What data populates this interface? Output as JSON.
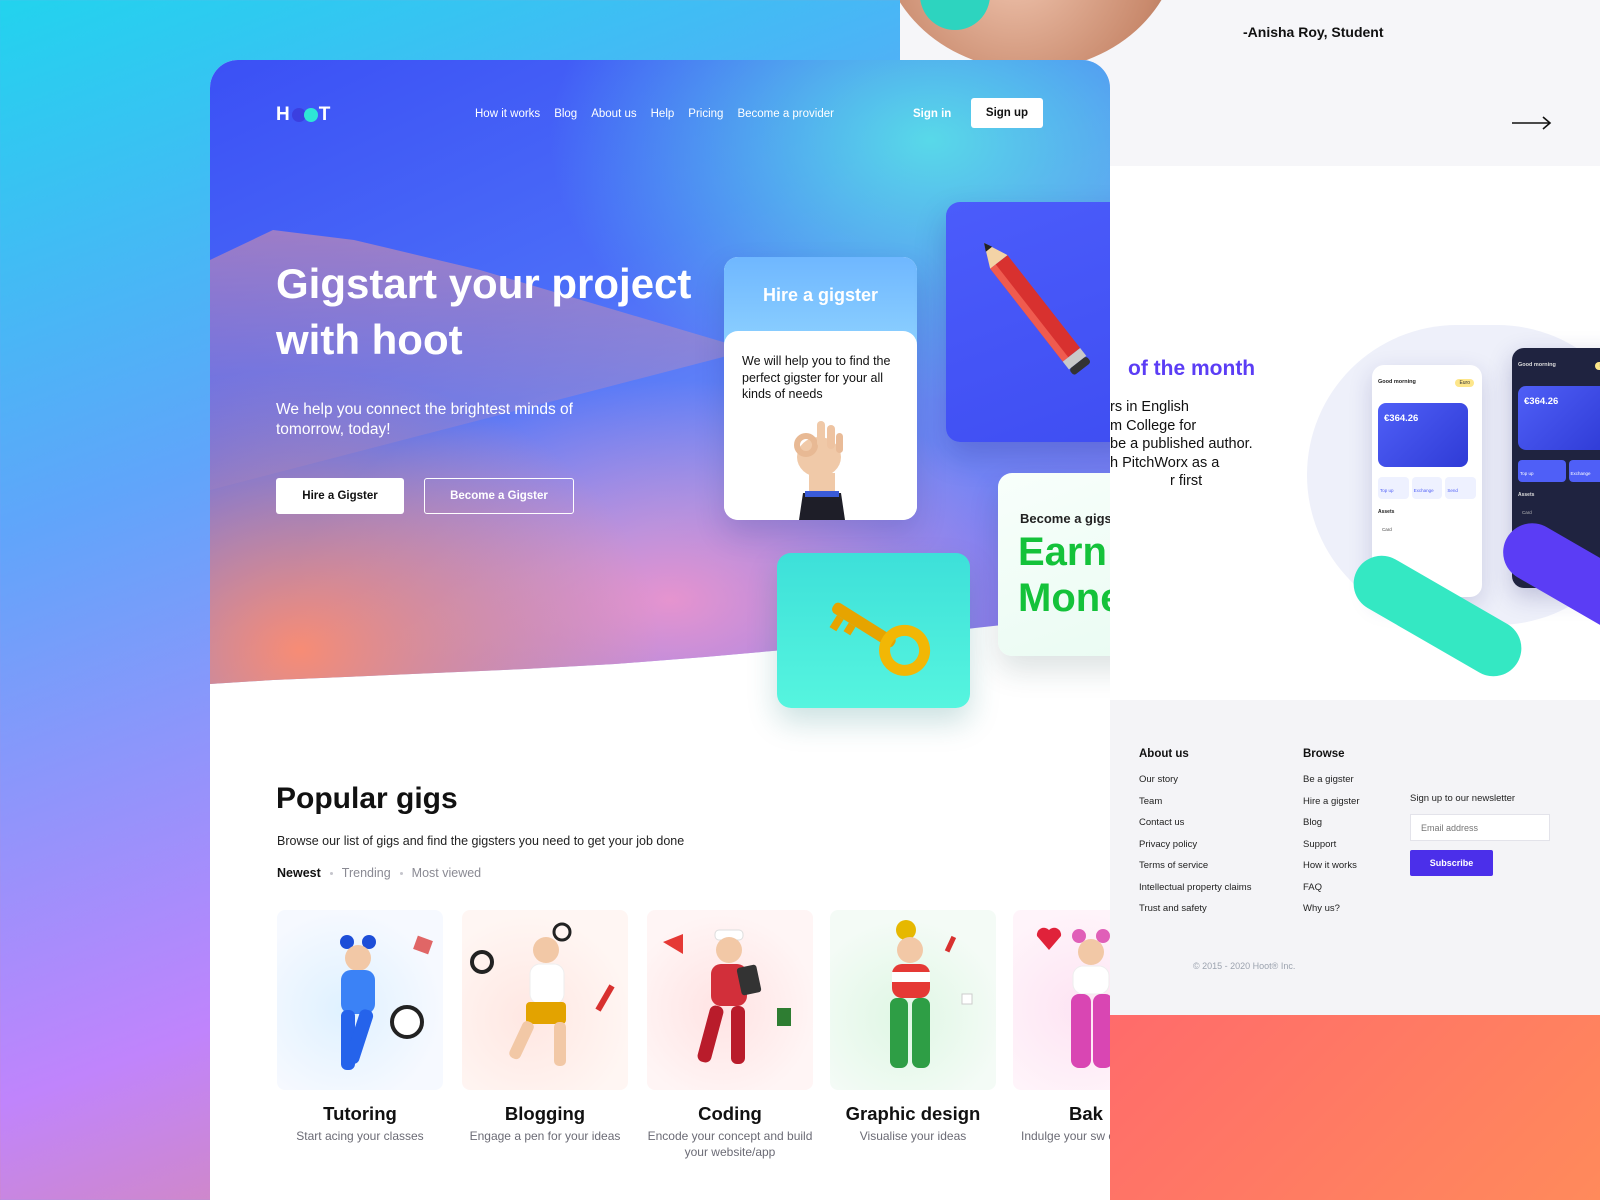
{
  "testimonial": {
    "author": "-Anisha Roy, Student"
  },
  "feature": {
    "title_fragment": "of the month",
    "text_lines": [
      "rs in English",
      "m College for",
      "be a published author.",
      "h PitchWorx as a",
      "r first"
    ]
  },
  "app_mock": {
    "greeting": "Good morning",
    "currency_pill": "Euro",
    "balance": "€364.26",
    "actions": [
      "Top up",
      "Exchange",
      "Send"
    ],
    "assets_label": "Assets",
    "card_label": "Card"
  },
  "footer": {
    "about_title": "About us",
    "about_links": [
      "Our story",
      "Team",
      "Contact us",
      "Privacy policy",
      "Terms of service",
      "Intellectual property claims",
      "Trust and safety"
    ],
    "browse_title": "Browse",
    "browse_links": [
      "Be a gigster",
      "Hire a gigster",
      "Blog",
      "Support",
      "How it works",
      "FAQ",
      "Why us?"
    ],
    "newsletter_label": "Sign up to our newsletter",
    "email_placeholder": "Email address",
    "subscribe_label": "Subscribe",
    "copyright": "© 2015 - 2020 Hoot® Inc."
  },
  "header": {
    "logo_h": "H",
    "logo_t": "T",
    "nav": [
      "How it works",
      "Blog",
      "About us",
      "Help",
      "Pricing",
      "Become a provider"
    ],
    "signin": "Sign in",
    "signup": "Sign up"
  },
  "hero": {
    "title": "Gigstart your project with hoot",
    "subtitle": "We help you connect the brightest minds of tomorrow, today!",
    "hire_button": "Hire a Gigster",
    "become_button": "Become a Gigster"
  },
  "cards": {
    "hire_title": "Hire a gigster",
    "hire_text": "We will help you to find the perfect gigster for your all kinds of needs",
    "earn_pre": "Become a gigster and",
    "earn_big": "Earn Money"
  },
  "popular": {
    "title": "Popular gigs",
    "subtitle": "Browse our list of gigs and find the gigsters you need to get your job done",
    "tabs": [
      "Newest",
      "Trending",
      "Most viewed"
    ],
    "gigs": [
      {
        "title": "Tutoring",
        "desc": "Start acing your classes"
      },
      {
        "title": "Blogging",
        "desc": "Engage a pen for your ideas"
      },
      {
        "title": "Coding",
        "desc": "Encode your concept and build your website/app"
      },
      {
        "title": "Graphic design",
        "desc": "Visualise your ideas"
      },
      {
        "title": "Bak",
        "desc": "Indulge your sw cakes and past"
      }
    ]
  },
  "colors": {
    "accent_purple": "#4b2fea",
    "earn_green": "#14c23a",
    "teal": "#34e8c3"
  }
}
